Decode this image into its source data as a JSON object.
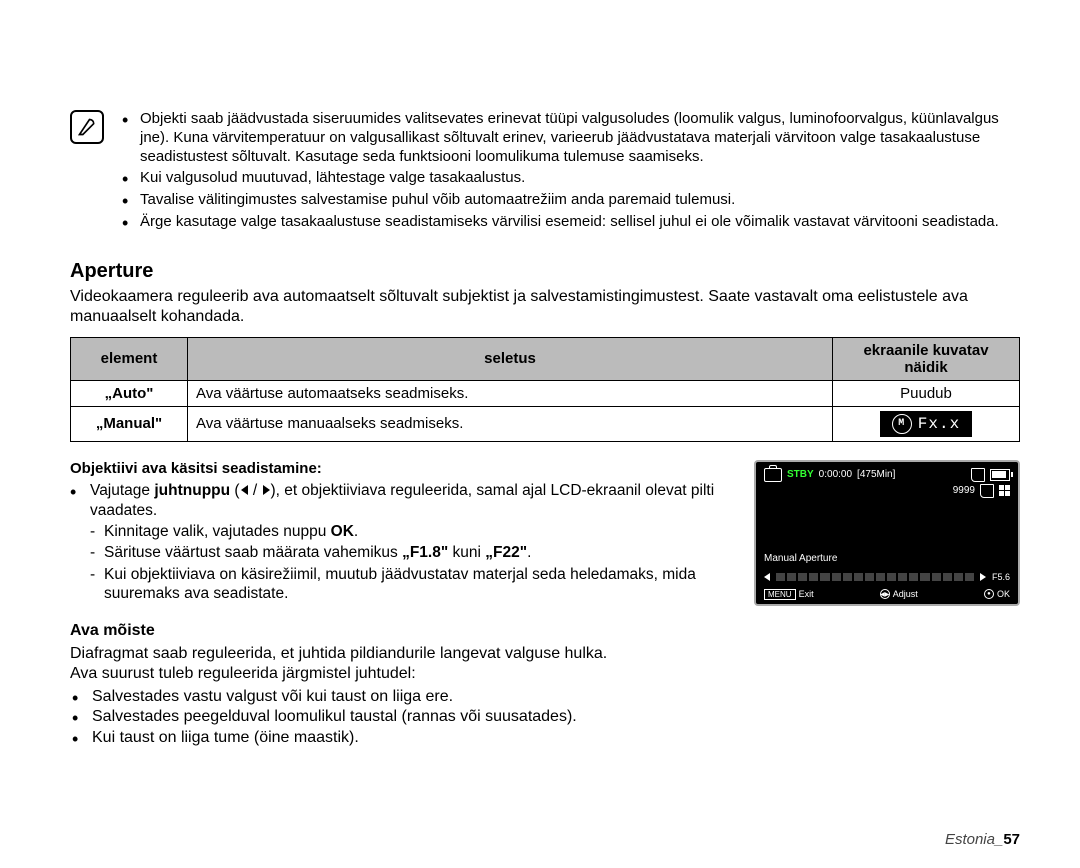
{
  "notes": [
    "Objekti saab jäädvustada siseruumides valitsevates erinevat tüüpi valgusoludes (loomulik valgus, luminofoorvalgus, küünlavalgus jne). Kuna värvitemperatuur on valgusallikast sõltuvalt erinev, varieerub jäädvustatava materjali värvitoon valge tasakaalustuse seadistustest sõltuvalt. Kasutage seda funktsiooni loomulikuma tulemuse saamiseks.",
    "Kui valgusolud muutuvad, lähtestage valge tasakaalustus.",
    "Tavalise välitingimustes salvestamise puhul võib automaatrežiim anda paremaid tulemusi.",
    "Ärge kasutage valge tasakaalustuse seadistamiseks värvilisi esemeid: sellisel juhul ei ole võimalik vastavat värvitooni seadistada."
  ],
  "aperture": {
    "heading": "Aperture",
    "intro": "Videokaamera reguleerib ava automaatselt sõltuvalt subjektist ja salvestamistingimustest. Saate vastavalt oma eelistustele ava manuaalselt kohandada.",
    "table": {
      "headers": {
        "element": "element",
        "desc": "seletus",
        "display": "ekraanile kuvatav näidik"
      },
      "rows": [
        {
          "label": "„Auto\"",
          "desc": "Ava väärtuse automaatseks seadmiseks.",
          "display": "Puudub",
          "badge": false
        },
        {
          "label": "„Manual\"",
          "desc": "Ava väärtuse manuaalseks seadmiseks.",
          "display": "Fx.x",
          "badge": true
        }
      ]
    }
  },
  "manual_set": {
    "heading": "Objektiivi ava käsitsi seadistamine:",
    "main_pre": "Vajutage ",
    "main_bold1": "juhtnuppu",
    "main_mid": " (",
    "main_post": "), et objektiiviava reguleerida, samal ajal LCD-ekraanil olevat pilti vaadates.",
    "sub": [
      "Kinnitage valik, vajutades nuppu OK.",
      "Särituse väärtust saab määrata vahemikus „F1.8\" kuni „F22\".",
      "Kui objektiiviava on käsirežiimil, muutub jäädvustatav materjal seda heledamaks, mida suuremaks ava seadistate."
    ],
    "sub1_bold": "OK",
    "sub1_plain": "Kinnitage valik, vajutades nuppu ",
    "sub1_end": ".",
    "sub2_pre": "Särituse väärtust saab määrata vahemikus ",
    "sub2_b1": "„F1.8\"",
    "sub2_mid": " kuni ",
    "sub2_b2": "„F22\"",
    "sub2_end": "."
  },
  "ava_moiste": {
    "heading": "Ava mõiste",
    "p1": "Diafragmat saab reguleerida, et juhtida pildiandurile langevat valguse hulka.",
    "p2": "Ava suurust tuleb reguleerida järgmistel juhtudel:",
    "items": [
      "Salvestades vastu valgust või kui taust on liiga ere.",
      "Salvestades peegelduval loomulikul taustal (rannas või suusatades).",
      "Kui taust on liiga tume (öine maastik)."
    ]
  },
  "screen": {
    "stby": "STBY",
    "time": "0:00:00",
    "remain": "[475Min]",
    "count": "9999",
    "mode_label": "Manual Aperture",
    "fvalue": "F5.6",
    "menu": "MENU",
    "exit": "Exit",
    "adjust": "Adjust",
    "ok": "OK"
  },
  "footer": {
    "text": "Estonia_",
    "page": "57"
  }
}
